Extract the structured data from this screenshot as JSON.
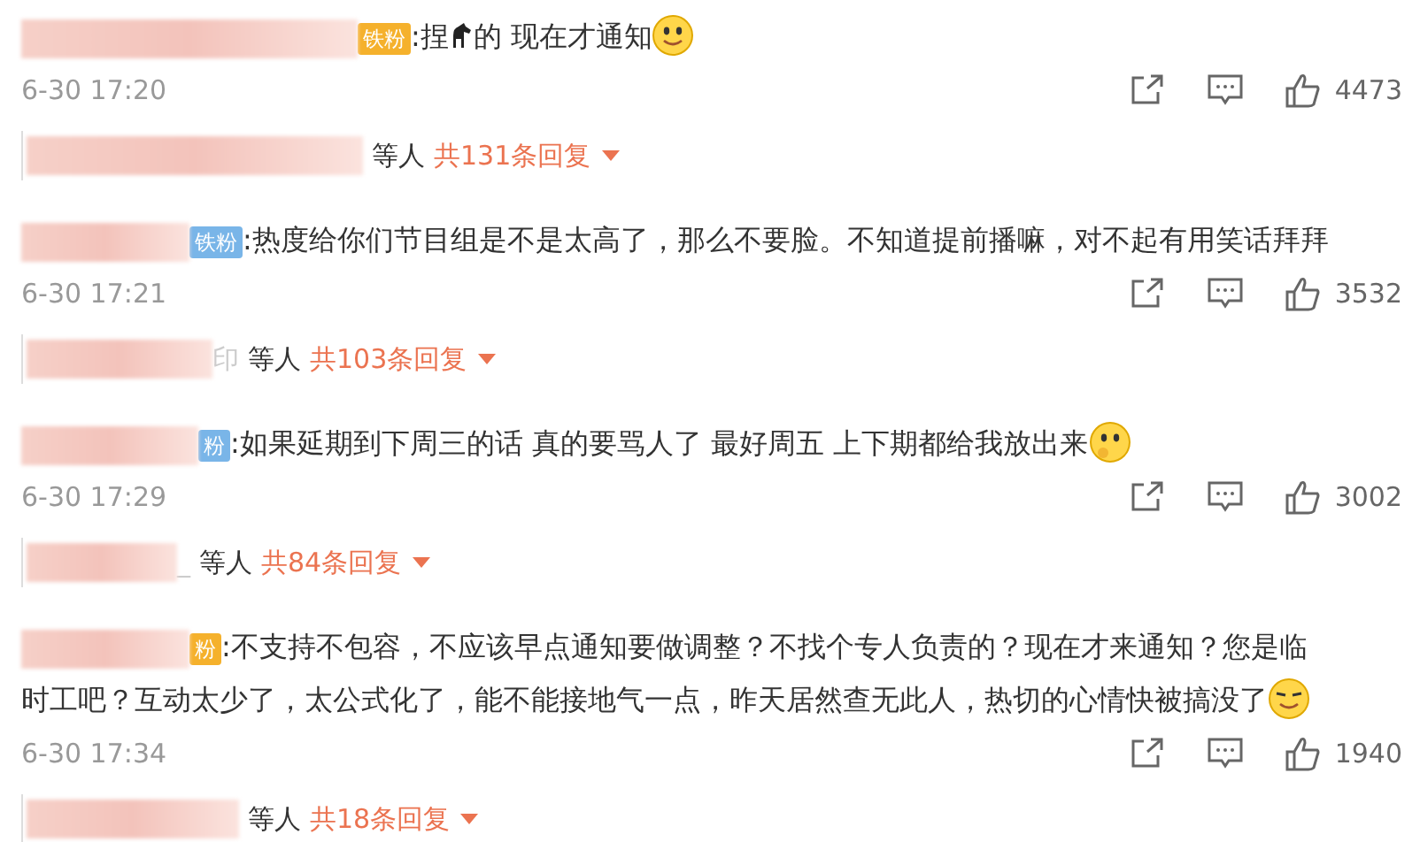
{
  "comments": [
    {
      "badge": {
        "text": "铁粉",
        "color": "#f5b12c"
      },
      "segments": [
        {
          "kind": "text",
          "text": ":捏"
        },
        {
          "kind": "horse"
        },
        {
          "kind": "text",
          "text": "的 现在才通知"
        },
        {
          "kind": "smile"
        }
      ],
      "time": "6-30 17:20",
      "likes": "4473",
      "replies": {
        "others": "等人",
        "count": "共131条回复"
      }
    },
    {
      "badge": {
        "text": "铁粉",
        "color": "#79b5e8"
      },
      "segments": [
        {
          "kind": "text",
          "text": ":热度给你们节目组是不是太高了，那么不要脸。不知道提前播嘛，对不起有用笑话拜拜"
        }
      ],
      "time": "6-30 17:21",
      "likes": "3532",
      "replies": {
        "name_tail": "印",
        "others": "等人",
        "count": "共103条回复"
      }
    },
    {
      "badge": {
        "text": "粉",
        "color": "#79b5e8"
      },
      "segments": [
        {
          "kind": "text",
          "text": ":如果延期到下周三的话 真的要骂人了 最好周五 上下期都给我放出来"
        },
        {
          "kind": "think"
        }
      ],
      "time": "6-30 17:29",
      "likes": "3002",
      "replies": {
        "name_tail": "_",
        "others": "等人",
        "count": "共84条回复"
      }
    },
    {
      "badge": {
        "text": "粉",
        "color": "#f5b12c"
      },
      "segments": [
        {
          "kind": "text",
          "text": ":不支持不包容，不应该早点通知要做调整？不找个专人负责的？现在才来通知？您是临"
        },
        {
          "kind": "newline"
        },
        {
          "kind": "text",
          "text": "时工吧？互动太少了，太公式化了，能不能接地气一点，昨天居然查无此人，热切的心情快被搞没了"
        },
        {
          "kind": "squint"
        }
      ],
      "time": "6-30 17:34",
      "likes": "1940",
      "replies": {
        "others": "等人",
        "count": "共18条回复"
      }
    }
  ]
}
